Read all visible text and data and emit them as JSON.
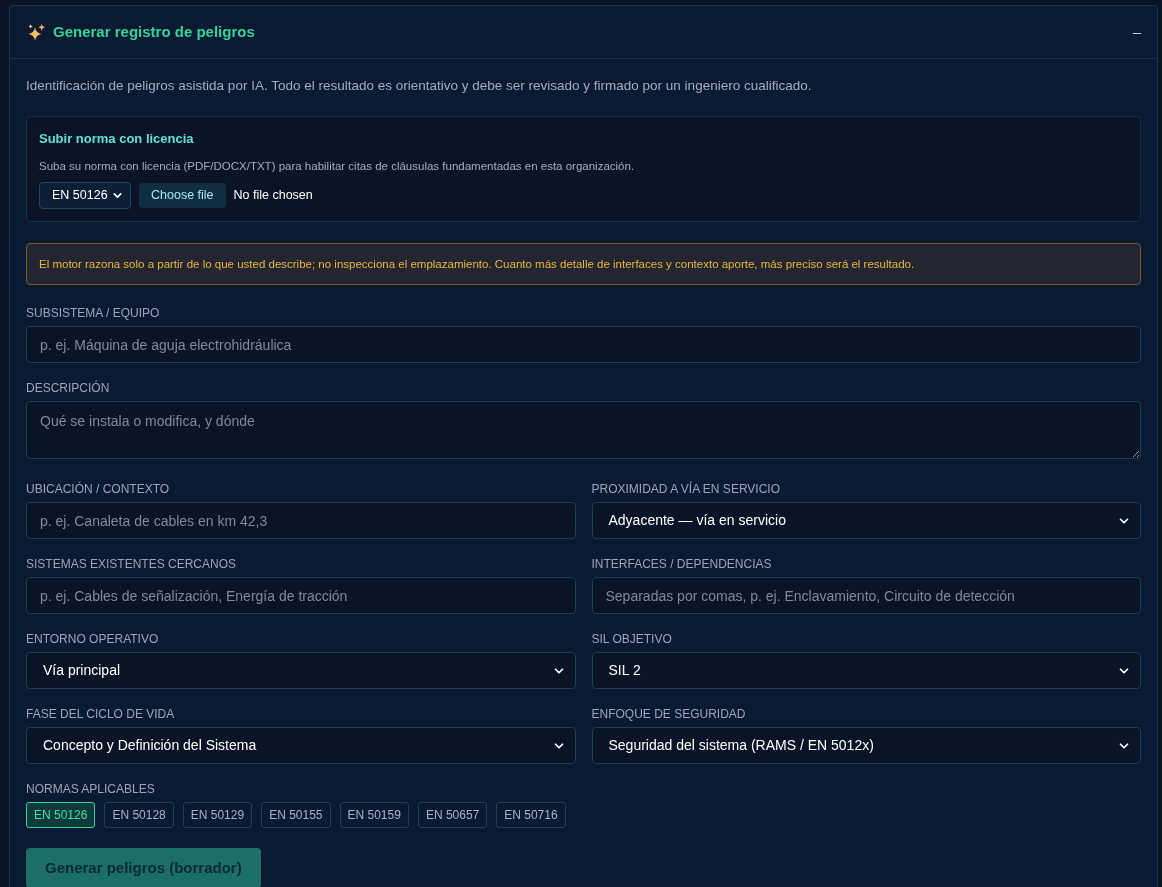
{
  "panel": {
    "title": "Generar registro de peligros",
    "collapse_label": "–"
  },
  "intro": "Identificación de peligros asistida por IA. Todo el resultado es orientativo y debe ser revisado y firmado por un ingeniero cualificado.",
  "upload": {
    "title": "Subir norma con licencia",
    "hint": "Suba su norma con licencia (PDF/DOCX/TXT) para habilitar citas de cláusulas fundamentadas en esta organización.",
    "standard_select": "EN 50126",
    "file_button": "Choose file",
    "file_status": "No file chosen"
  },
  "notice": "El motor razona solo a partir de lo que usted describe; no inspecciona el emplazamiento. Cuanto más detalle de interfaces y contexto aporte, más preciso será el resultado.",
  "full_fields": [
    {
      "kind": "text",
      "label": "SUBSISTEMA / EQUIPO",
      "placeholder": "p. ej. Máquina de aguja electrohidráulica"
    },
    {
      "kind": "textarea",
      "label": "DESCRIPCIÓN",
      "placeholder": "Qué se instala o modifica, y dónde"
    }
  ],
  "grid_fields": [
    {
      "kind": "text",
      "label": "UBICACIÓN / CONTEXTO",
      "placeholder": "p. ej. Canaleta de cables en km 42,3"
    },
    {
      "kind": "select",
      "label": "PROXIMIDAD A VÍA EN SERVICIO",
      "value": "Adyacente — vía en servicio"
    },
    {
      "kind": "text",
      "label": "SISTEMAS EXISTENTES CERCANOS",
      "placeholder": "p. ej. Cables de señalización, Energía de tracción"
    },
    {
      "kind": "text",
      "label": "INTERFACES / DEPENDENCIAS",
      "placeholder": "Separadas por comas, p. ej. Enclavamiento, Circuito de detección"
    },
    {
      "kind": "select",
      "label": "ENTORNO OPERATIVO",
      "value": "Vía principal"
    },
    {
      "kind": "select",
      "label": "SIL OBJETIVO",
      "value": "SIL 2"
    },
    {
      "kind": "select",
      "label": "FASE DEL CICLO DE VIDA",
      "value": "Concepto y Definición del Sistema"
    },
    {
      "kind": "select",
      "label": "ENFOQUE DE SEGURIDAD",
      "value": "Seguridad del sistema (RAMS / EN 5012x)"
    }
  ],
  "standards": {
    "label": "NORMAS APLICABLES",
    "items": [
      {
        "label": "EN 50126",
        "selected": true
      },
      {
        "label": "EN 50128",
        "selected": false
      },
      {
        "label": "EN 50129",
        "selected": false
      },
      {
        "label": "EN 50155",
        "selected": false
      },
      {
        "label": "EN 50159",
        "selected": false
      },
      {
        "label": "EN 50657",
        "selected": false
      },
      {
        "label": "EN 50716",
        "selected": false
      }
    ]
  },
  "generate_button": "Generar peligros (borrador)"
}
